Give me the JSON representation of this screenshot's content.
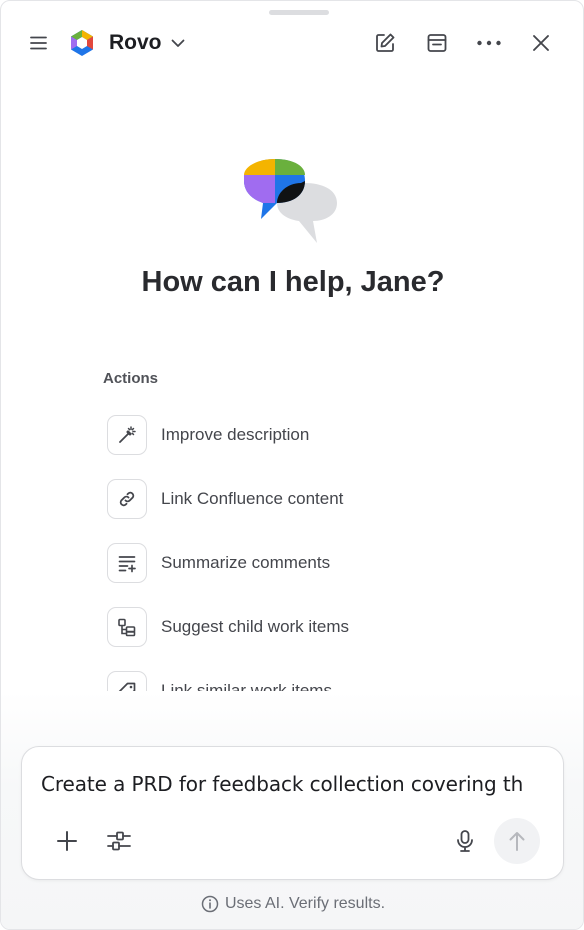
{
  "header": {
    "app_name": "Rovo"
  },
  "greeting": "How can I help, Jane?",
  "actions": {
    "heading": "Actions",
    "items": [
      {
        "label": "Improve description",
        "icon": "magic-wand-icon"
      },
      {
        "label": "Link Confluence content",
        "icon": "link-icon"
      },
      {
        "label": "Summarize comments",
        "icon": "summarize-list-icon"
      },
      {
        "label": "Suggest child work items",
        "icon": "child-items-icon"
      },
      {
        "label": "Link similar work items",
        "icon": "tag-icon"
      }
    ]
  },
  "composer": {
    "text": "Create a PRD for feedback collection covering th"
  },
  "disclaimer": "Uses AI. Verify results.",
  "colors": {
    "accent_purple": "#a06cf0",
    "accent_blue": "#1f75e8",
    "accent_green": "#6ab03d",
    "accent_yellow": "#f4b400",
    "text_primary": "#292a2e"
  }
}
